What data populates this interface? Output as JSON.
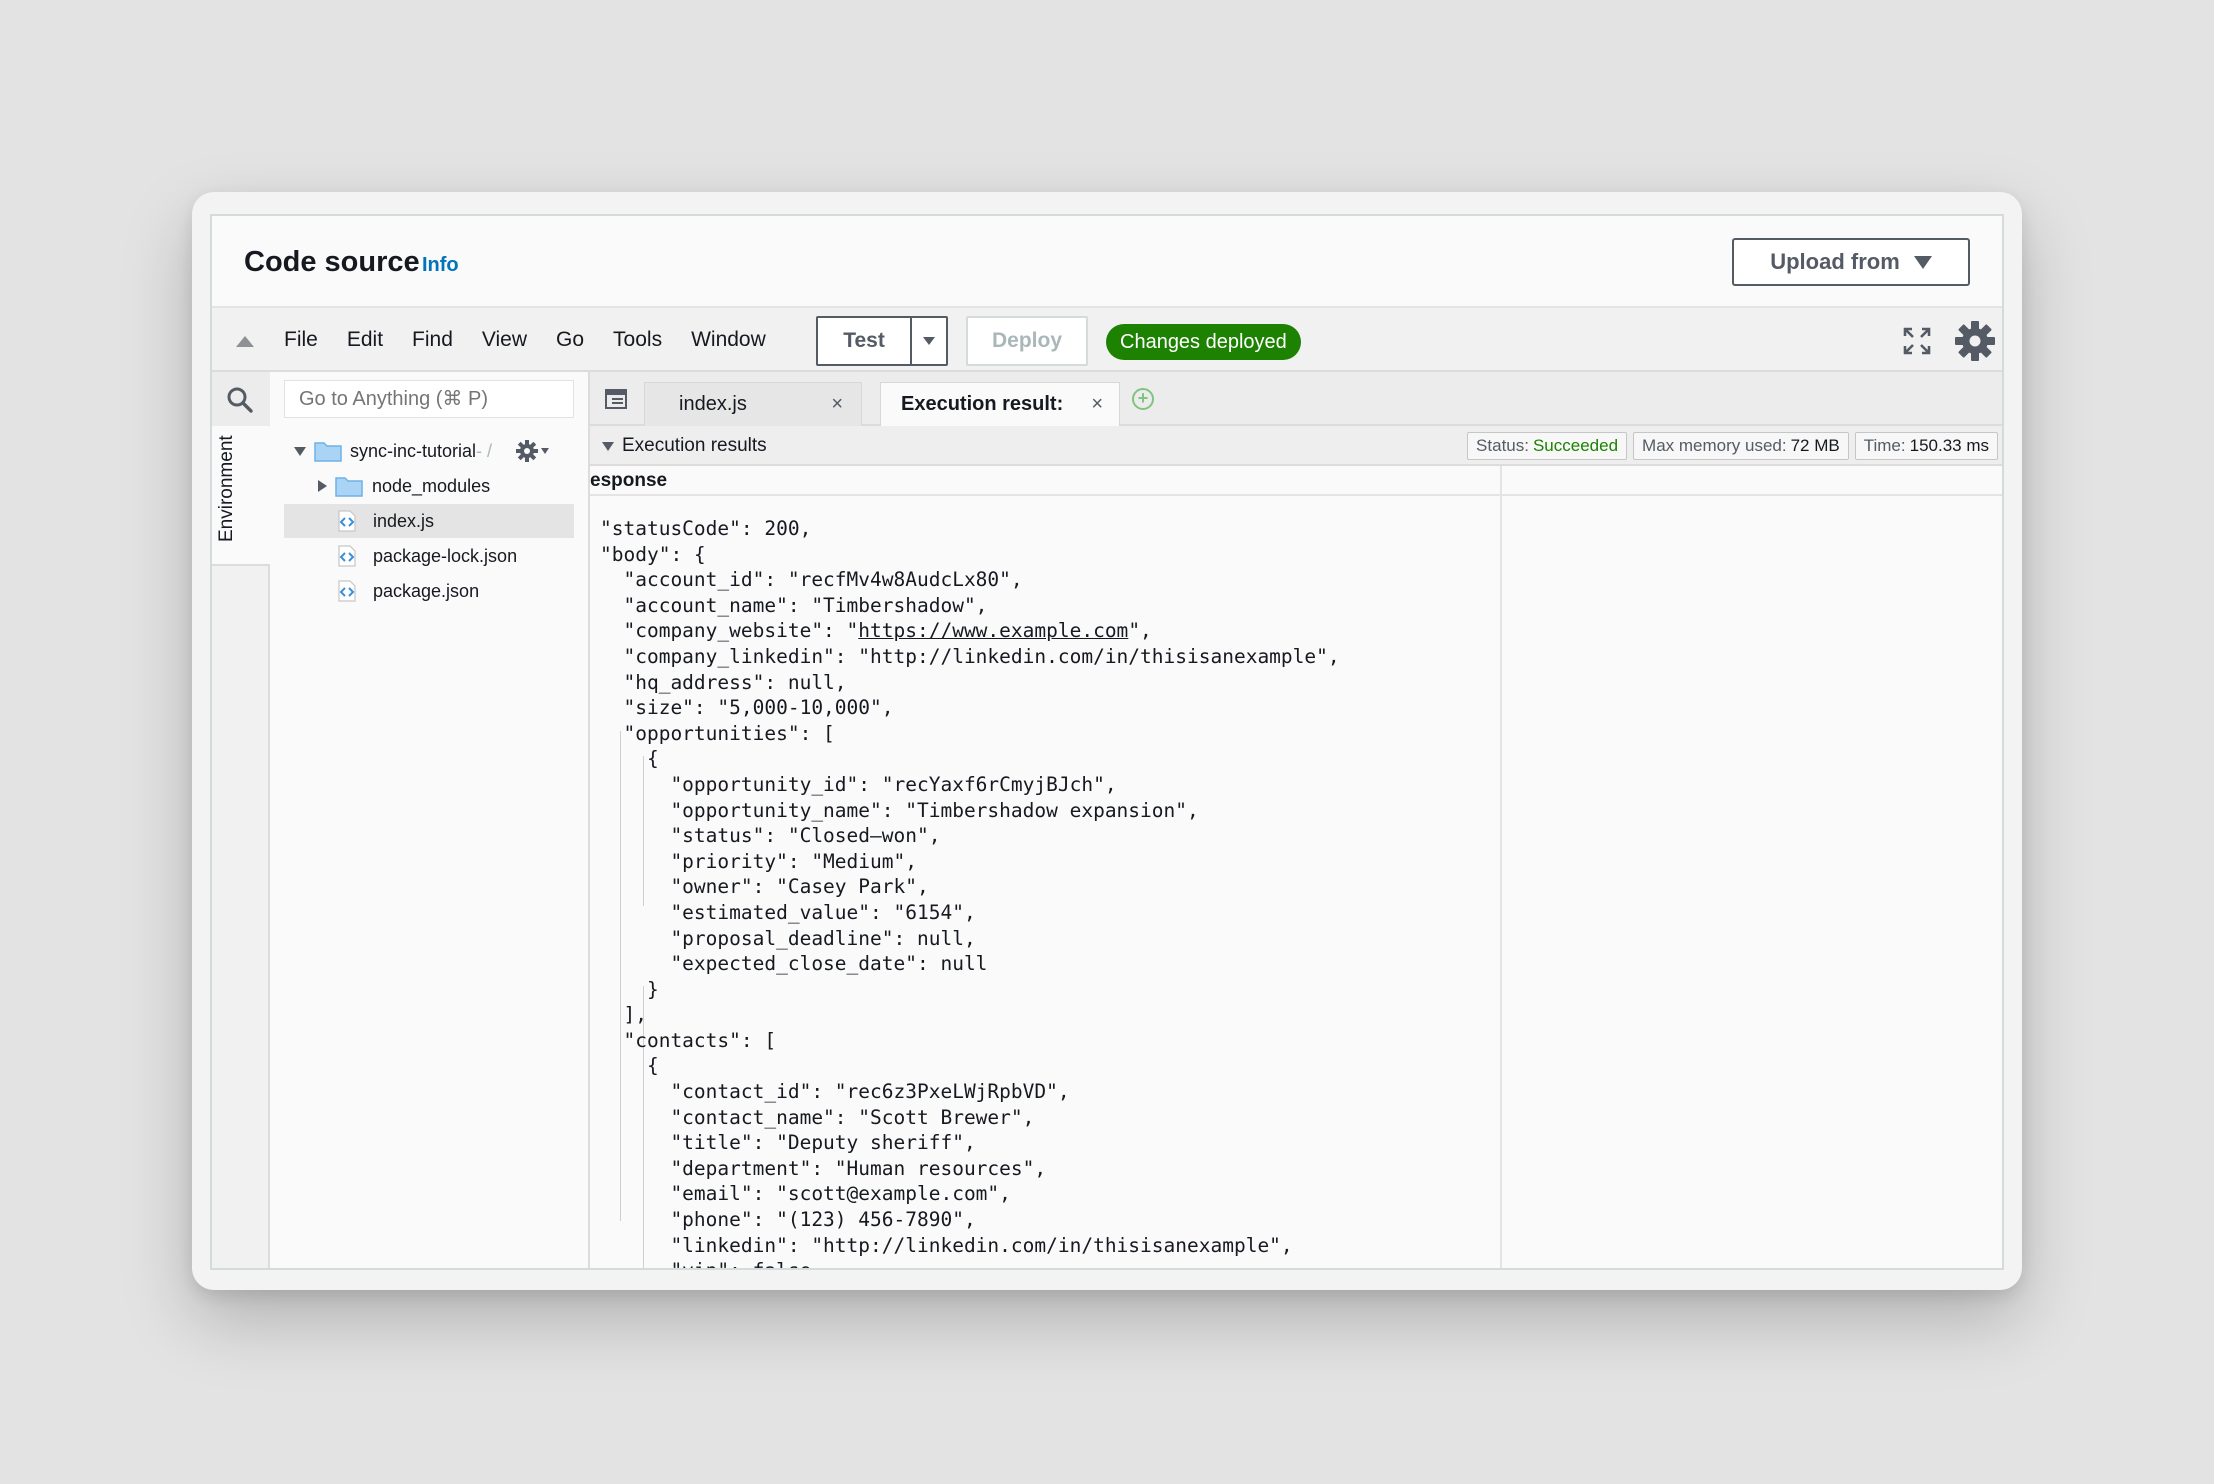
{
  "header": {
    "title": "Code source",
    "info_link": "Info",
    "upload_label": "Upload from"
  },
  "toolbar": {
    "menu": [
      "File",
      "Edit",
      "Find",
      "View",
      "Go",
      "Tools",
      "Window"
    ],
    "test_label": "Test",
    "deploy_label": "Deploy",
    "deployed_badge": "Changes deployed"
  },
  "sidebar": {
    "tab_label": "Environment",
    "search_placeholder": "Go to Anything (⌘ P)",
    "root_folder": "sync-inc-tutorial",
    "root_suffix": " - /",
    "items": [
      {
        "label": "node_modules",
        "type": "folder"
      },
      {
        "label": "index.js",
        "type": "file"
      },
      {
        "label": "package-lock.json",
        "type": "file"
      },
      {
        "label": "package.json",
        "type": "file"
      }
    ]
  },
  "tabs": [
    {
      "label": "index.js",
      "close": "×"
    },
    {
      "label": "Execution result:",
      "close": "×"
    }
  ],
  "results": {
    "title": "Execution results",
    "status_label": "Status:",
    "status_value": "Succeeded",
    "memory_label": "Max memory used:",
    "memory_value": "72 MB",
    "time_label": "Time:",
    "time_value": "150.33 ms",
    "response_label": "esponse"
  },
  "code": {
    "lines_before_link": "\"statusCode\": 200,\n\"body\": {\n  \"account_id\": \"recfMv4w8AudcLx80\",\n  \"account_name\": \"Timbershadow\",\n  \"company_website\": \"",
    "link": "https://www.example.com",
    "lines_after_link": "\",\n  \"company_linkedin\": \"http://linkedin.com/in/thisisanexample\",\n  \"hq_address\": null,\n  \"size\": \"5,000-10,000\",\n  \"opportunities\": [\n    {\n      \"opportunity_id\": \"recYaxf6rCmyjBJch\",\n      \"opportunity_name\": \"Timbershadow expansion\",\n      \"status\": \"Closed–won\",\n      \"priority\": \"Medium\",\n      \"owner\": \"Casey Park\",\n      \"estimated_value\": \"6154\",\n      \"proposal_deadline\": null,\n      \"expected_close_date\": null\n    }\n  ],\n  \"contacts\": [\n    {\n      \"contact_id\": \"rec6z3PxeLWjRpbVD\",\n      \"contact_name\": \"Scott Brewer\",\n      \"title\": \"Deputy sheriff\",\n      \"department\": \"Human resources\",\n      \"email\": \"scott@example.com\",\n      \"phone\": \"(123) 456-7890\",\n      \"linkedin\": \"http://linkedin.com/in/thisisanexample\",\n      \"vip\": false"
  },
  "colors": {
    "accent": "#0073bb",
    "success": "#1d8102"
  }
}
